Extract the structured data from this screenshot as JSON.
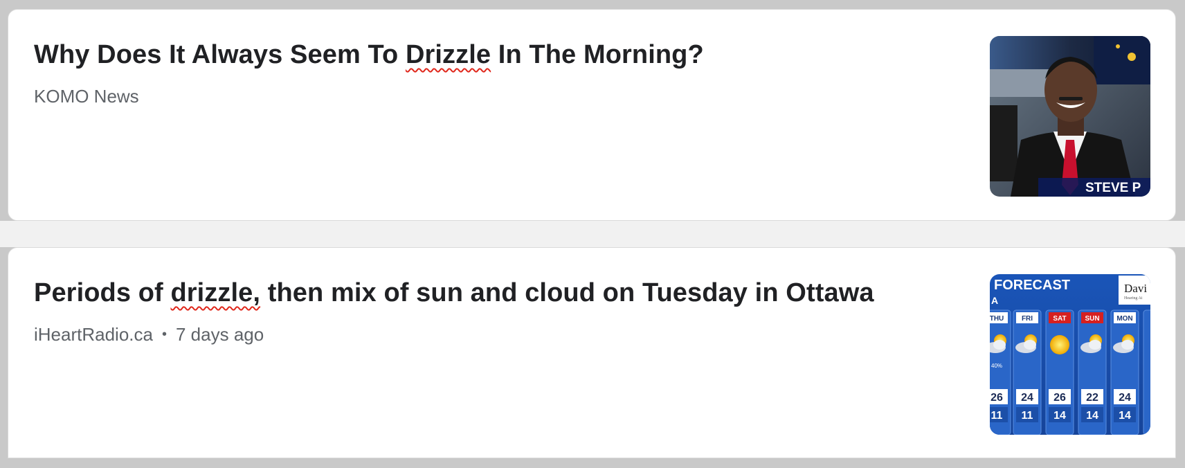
{
  "articles": [
    {
      "headline_before": "Why Does It Always Seem To ",
      "headline_highlight": "Drizzle",
      "headline_after": " In The Morning?",
      "source": "KOMO News",
      "time": "",
      "thumbnail": {
        "kind": "news-anchor-photo",
        "caption": "STEVE P"
      }
    },
    {
      "headline_before": "Periods of ",
      "headline_highlight": "drizzle,",
      "headline_after": " then mix of sun and cloud on Tuesday in Ottawa",
      "source": "iHeartRadio.ca",
      "separator": "•",
      "time": "7 days ago",
      "thumbnail": {
        "kind": "weather-forecast-graphic",
        "title": "FORECAST",
        "subtitle": "A",
        "sponsor": "Davi",
        "sponsor_sub": "Hearing Ai",
        "days": [
          "THU",
          "FRI",
          "SAT",
          "SUN",
          "MON"
        ],
        "highs": [
          "26",
          "24",
          "26",
          "22",
          "24"
        ],
        "lows": [
          "11",
          "11",
          "14",
          "14",
          "14"
        ],
        "pop": "40%"
      }
    }
  ],
  "colors": {
    "background": "#c9c9c9",
    "card": "#ffffff",
    "headline": "#202124",
    "meta": "#5f6368",
    "squiggle": "#e0271b",
    "forecast_blue": "#1c4fa8",
    "weekend_red": "#d62020"
  }
}
